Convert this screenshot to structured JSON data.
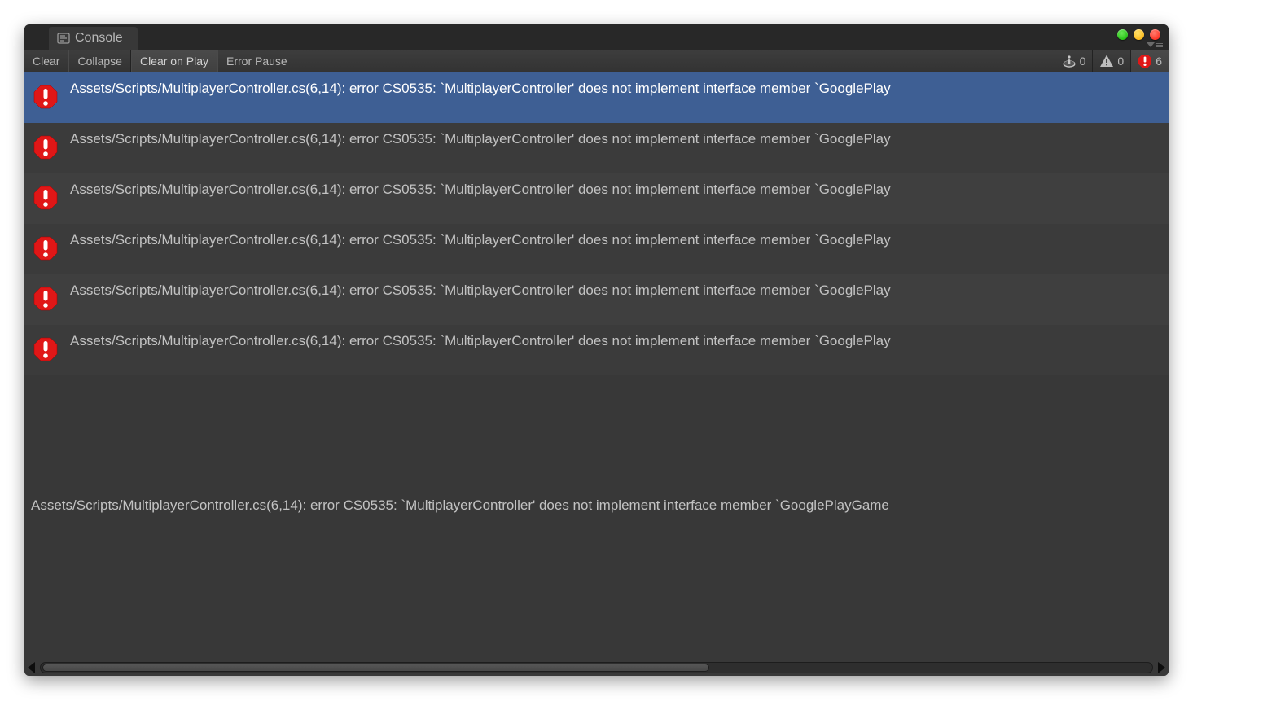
{
  "tab": {
    "title": "Console"
  },
  "toolbar": {
    "clear": "Clear",
    "collapse": "Collapse",
    "clear_on_play": "Clear on Play",
    "error_pause": "Error Pause"
  },
  "filters": {
    "info_count": "0",
    "warn_count": "0",
    "error_count": "6"
  },
  "logs": [
    {
      "message": "Assets/Scripts/MultiplayerController.cs(6,14): error CS0535: `MultiplayerController' does not implement interface member `GooglePlay",
      "selected": true
    },
    {
      "message": "Assets/Scripts/MultiplayerController.cs(6,14): error CS0535: `MultiplayerController' does not implement interface member `GooglePlay",
      "selected": false
    },
    {
      "message": "Assets/Scripts/MultiplayerController.cs(6,14): error CS0535: `MultiplayerController' does not implement interface member `GooglePlay",
      "selected": false
    },
    {
      "message": "Assets/Scripts/MultiplayerController.cs(6,14): error CS0535: `MultiplayerController' does not implement interface member `GooglePlay",
      "selected": false
    },
    {
      "message": "Assets/Scripts/MultiplayerController.cs(6,14): error CS0535: `MultiplayerController' does not implement interface member `GooglePlay",
      "selected": false
    },
    {
      "message": "Assets/Scripts/MultiplayerController.cs(6,14): error CS0535: `MultiplayerController' does not implement interface member `GooglePlay",
      "selected": false
    }
  ],
  "detail": {
    "text": "Assets/Scripts/MultiplayerController.cs(6,14): error CS0535: `MultiplayerController' does not implement interface member `GooglePlayGame"
  }
}
